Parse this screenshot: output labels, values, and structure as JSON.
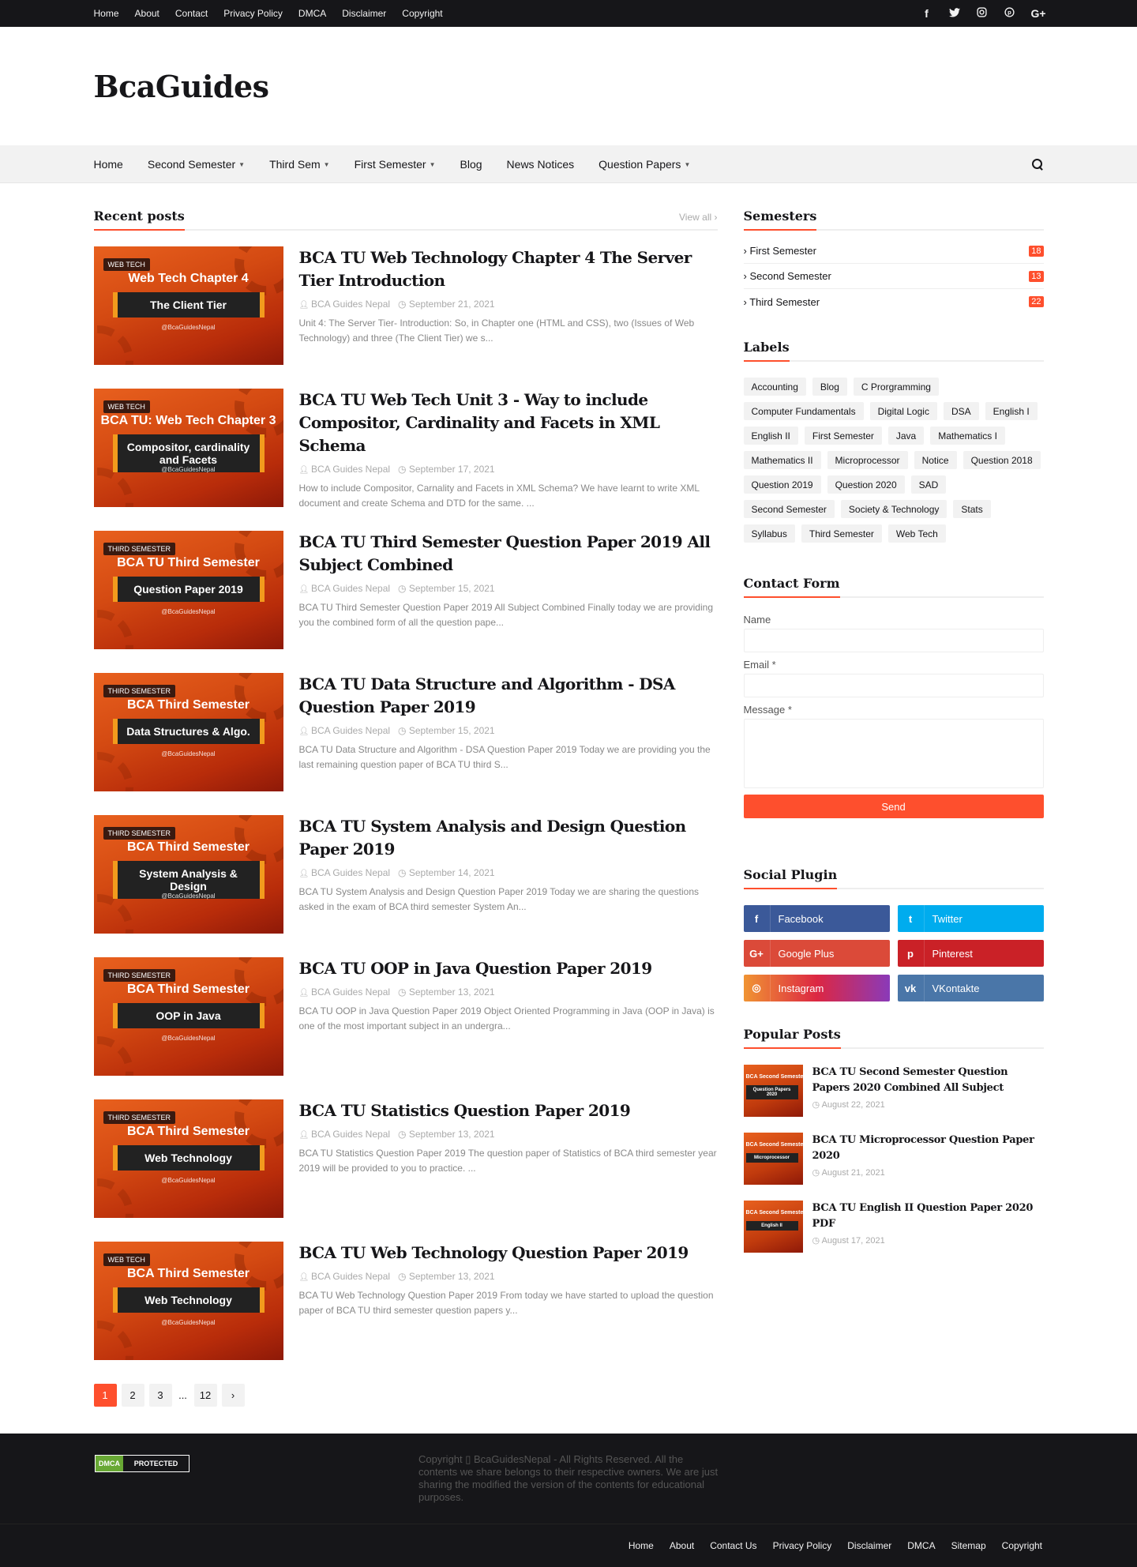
{
  "topbar": {
    "links": [
      "Home",
      "About",
      "Contact",
      "Privacy Policy",
      "DMCA",
      "Disclaimer",
      "Copyright"
    ],
    "social_icons": [
      "facebook-icon",
      "twitter-icon",
      "instagram-icon",
      "pinterest-icon",
      "google-plus-icon"
    ]
  },
  "header": {
    "logo": "BcaGuides"
  },
  "nav": {
    "items": [
      {
        "label": "Home",
        "dropdown": false
      },
      {
        "label": "Second Semester",
        "dropdown": true
      },
      {
        "label": "Third Sem",
        "dropdown": true
      },
      {
        "label": "First Semester",
        "dropdown": true
      },
      {
        "label": "Blog",
        "dropdown": false
      },
      {
        "label": "News Notices",
        "dropdown": false
      },
      {
        "label": "Question Papers",
        "dropdown": true
      }
    ]
  },
  "recent": {
    "title": "Recent posts",
    "view_all": "View all",
    "posts": [
      {
        "tag": "WEB TECH",
        "thumb_title": "Web Tech Chapter 4",
        "thumb_band": "The Client Tier",
        "thumb_handle": "@BcaGuidesNepal",
        "title": "BCA TU Web Technology Chapter 4 The Server Tier Introduction",
        "author": "BCA Guides Nepal",
        "date": "September 21, 2021",
        "snippet": "Unit 4: The Server Tier-  Introduction: So, in Chapter one (HTML and CSS), two (Issues of Web Technology) and three (The Client Tier) we s..."
      },
      {
        "tag": "WEB TECH",
        "thumb_title": "BCA TU: Web Tech Chapter 3",
        "thumb_band": "Compositor, cardinality and Facets",
        "thumb_handle": "@BcaGuidesNepal",
        "title": "BCA TU Web Tech Unit 3 - Way to include Compositor, Cardinality and Facets in XML Schema",
        "author": "BCA Guides Nepal",
        "date": "September 17, 2021",
        "snippet": "How to include Compositor, Carnality and Facets in XML Schema? We have learnt to write XML document and create Schema and DTD for the same. ..."
      },
      {
        "tag": "THIRD SEMESTER",
        "thumb_title": "BCA TU Third Semester",
        "thumb_band": "Question Paper 2019",
        "thumb_handle": "@BcaGuidesNepal",
        "title": "BCA TU Third Semester Question Paper 2019 All Subject Combined",
        "author": "BCA Guides Nepal",
        "date": "September 15, 2021",
        "snippet": "BCA TU Third Semester Question Paper 2019 All Subject Combined Finally today we are providing you the combined form of all the question pape..."
      },
      {
        "tag": "THIRD SEMESTER",
        "thumb_title": "BCA Third Semester",
        "thumb_band": "Data Structures & Algo.",
        "thumb_handle": "@BcaGuidesNepal",
        "title": "BCA TU Data Structure and Algorithm - DSA Question Paper 2019",
        "author": "BCA Guides Nepal",
        "date": "September 15, 2021",
        "snippet": "BCA TU Data Structure and Algorithm - DSA Question Paper 2019 Today we are providing you the last remaining question paper of BCA TU third S..."
      },
      {
        "tag": "THIRD SEMESTER",
        "thumb_title": "BCA Third Semester",
        "thumb_band": "System Analysis & Design",
        "thumb_handle": "@BcaGuidesNepal",
        "title": "BCA TU System Analysis and Design Question Paper 2019",
        "author": "BCA Guides Nepal",
        "date": "September 14, 2021",
        "snippet": "BCA TU System Analysis and Design Question Paper 2019  Today we are sharing the questions asked in the exam of BCA third semester System An..."
      },
      {
        "tag": "THIRD SEMESTER",
        "thumb_title": "BCA Third Semester",
        "thumb_band": "OOP in Java",
        "thumb_handle": "@BcaGuidesNepal",
        "title": "BCA TU OOP in Java Question Paper 2019",
        "author": "BCA Guides Nepal",
        "date": "September 13, 2021",
        "snippet": "BCA TU OOP in Java Question Paper 2019 Object Oriented Programming in Java (OOP in Java) is one of the most important subject in an undergra..."
      },
      {
        "tag": "THIRD SEMESTER",
        "thumb_title": "BCA Third Semester",
        "thumb_band": "Web Technology",
        "thumb_handle": "@BcaGuidesNepal",
        "title": "BCA TU Statistics Question Paper 2019",
        "author": "BCA Guides Nepal",
        "date": "September 13, 2021",
        "snippet": "BCA TU Statistics Question Paper 2019 The question paper of Statistics of BCA third semester year 2019 will be provided to you to practice. ..."
      },
      {
        "tag": "WEB TECH",
        "thumb_title": "BCA Third Semester",
        "thumb_band": "Web Technology",
        "thumb_handle": "@BcaGuidesNepal",
        "title": "BCA TU Web Technology Question Paper 2019",
        "author": "BCA Guides Nepal",
        "date": "September 13, 2021",
        "snippet": "BCA TU Web Technology Question Paper 2019 From today we have started to upload the question paper of BCA TU third semester question papers y..."
      }
    ],
    "pagination": [
      "1",
      "2",
      "3",
      "...",
      "12",
      "›"
    ]
  },
  "sidebar": {
    "semesters": {
      "title": "Semesters",
      "items": [
        {
          "label": "First Semester",
          "count": "18"
        },
        {
          "label": "Second Semester",
          "count": "13"
        },
        {
          "label": "Third Semester",
          "count": "22"
        }
      ]
    },
    "labels": {
      "title": "Labels",
      "items": [
        "Accounting",
        "Blog",
        "C Prorgramming",
        "Computer Fundamentals",
        "Digital Logic",
        "DSA",
        "English I",
        "English II",
        "First Semester",
        "Java",
        "Mathematics I",
        "Mathematics II",
        "Microprocessor",
        "Notice",
        "Question 2018",
        "Question 2019",
        "Question 2020",
        "SAD",
        "Second Semester",
        "Society & Technology",
        "Stats",
        "Syllabus",
        "Third Semester",
        "Web Tech"
      ]
    },
    "contact": {
      "title": "Contact Form",
      "name_label": "Name",
      "email_label": "Email *",
      "message_label": "Message *",
      "send": "Send"
    },
    "social": {
      "title": "Social Plugin",
      "items": [
        {
          "label": "Facebook",
          "icon": "f",
          "color": "#3b5999"
        },
        {
          "label": "Twitter",
          "icon": "t",
          "color": "#00acee"
        },
        {
          "label": "Google Plus",
          "icon": "G+",
          "color": "#db4a39"
        },
        {
          "label": "Pinterest",
          "icon": "p",
          "color": "#ca2127"
        },
        {
          "label": "Instagram",
          "icon": "◎",
          "color": "#dd4d6d"
        },
        {
          "label": "VKontakte",
          "icon": "vk",
          "color": "#4a76a8"
        }
      ]
    },
    "popular": {
      "title": "Popular Posts",
      "items": [
        {
          "thumb_title": "BCA Second Semester",
          "thumb_band": "Question Papers 2020",
          "title": "BCA TU Second Semester Question Papers 2020 Combined All Subject",
          "date": "August 22, 2021"
        },
        {
          "thumb_title": "BCA Second Semester",
          "thumb_band": "Microprocessor",
          "title": "BCA TU Microprocessor Question Paper 2020",
          "date": "August 21, 2021"
        },
        {
          "thumb_title": "BCA Second Semester",
          "thumb_band": "English II",
          "title": "BCA TU English II Question Paper 2020 PDF",
          "date": "August 17, 2021"
        }
      ]
    }
  },
  "footer": {
    "dmca_left": "DMCA",
    "dmca_right": "PROTECTED",
    "copyright": "Copyright ▯ BcaGuidesNepal - All Rights Reserved. All the contents we share belongs to their respective owners. We are just sharing the modified the version of the contents for educational purposes.",
    "links": [
      "Home",
      "About",
      "Contact Us",
      "Privacy Policy",
      "Disclaimer",
      "DMCA",
      "Sitemap",
      "Copyright"
    ]
  },
  "colors": {
    "accent": "#fe4f2d",
    "dark": "#161619",
    "light_bg": "#f2f2f2"
  }
}
